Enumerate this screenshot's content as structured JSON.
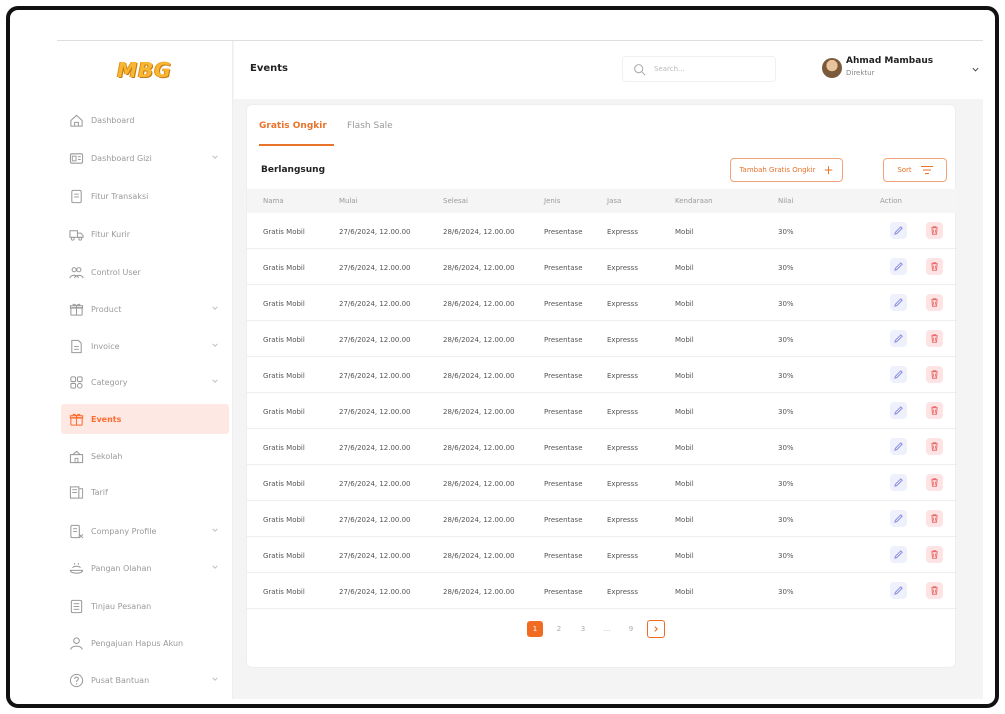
{
  "app": {
    "logo": "MBG",
    "accent": "#e8732a"
  },
  "sidebar": {
    "items": [
      {
        "label": "Dashboard",
        "icon": "home-icon",
        "chevron": false,
        "active": false
      },
      {
        "label": "Dashboard Gizi",
        "icon": "dashboard-gizi-icon",
        "chevron": true,
        "active": false
      },
      {
        "label": "Fitur Transaksi",
        "icon": "document-icon",
        "chevron": false,
        "active": false
      },
      {
        "label": "Fitur Kurir",
        "icon": "truck-icon",
        "chevron": false,
        "active": false
      },
      {
        "label": "Control User",
        "icon": "users-icon",
        "chevron": false,
        "active": false
      },
      {
        "label": "Product",
        "icon": "gift-icon",
        "chevron": true,
        "active": false
      },
      {
        "label": "Invoice",
        "icon": "invoice-icon",
        "chevron": true,
        "active": false
      },
      {
        "label": "Category",
        "icon": "category-icon",
        "chevron": true,
        "active": false
      },
      {
        "label": "Events",
        "icon": "gift-icon",
        "chevron": false,
        "active": true
      },
      {
        "label": "Sekolah",
        "icon": "school-icon",
        "chevron": false,
        "active": false
      },
      {
        "label": "Tarif",
        "icon": "tarif-icon",
        "chevron": false,
        "active": false
      },
      {
        "label": "Company Profile",
        "icon": "company-icon",
        "chevron": true,
        "active": false
      },
      {
        "label": "Pangan Olahan",
        "icon": "food-icon",
        "chevron": true,
        "active": false
      },
      {
        "label": "Tinjau Pesanan",
        "icon": "list-icon",
        "chevron": false,
        "active": false
      },
      {
        "label": "Pengajuan Hapus Akun",
        "icon": "user-delete-icon",
        "chevron": false,
        "active": false
      },
      {
        "label": "Pusat Bantuan",
        "icon": "help-icon",
        "chevron": true,
        "active": false
      }
    ]
  },
  "header": {
    "title": "Events",
    "search_placeholder": "Search...",
    "user_name": "Ahmad Mambaus",
    "user_role": "Direktur"
  },
  "tabs": [
    {
      "label": "Gratis Ongkir",
      "active": true
    },
    {
      "label": "Flash Sale",
      "active": false
    }
  ],
  "section": {
    "title": "Berlangsung",
    "add_label": "Tambah Gratis Ongkir",
    "sort_label": "Sort"
  },
  "table": {
    "columns": [
      "Nama",
      "Mulai",
      "Selesai",
      "Jenis",
      "Jasa",
      "Kendaraan",
      "Nilai",
      "Action"
    ],
    "rows": [
      [
        "Gratis Mobil",
        "27/6/2024, 12.00.00",
        "28/6/2024, 12.00.00",
        "Presentase",
        "Expresss",
        "Mobil",
        "30%"
      ],
      [
        "Gratis Mobil",
        "27/6/2024, 12.00.00",
        "28/6/2024, 12.00.00",
        "Presentase",
        "Expresss",
        "Mobil",
        "30%"
      ],
      [
        "Gratis Mobil",
        "27/6/2024, 12.00.00",
        "28/6/2024, 12.00.00",
        "Presentase",
        "Expresss",
        "Mobil",
        "30%"
      ],
      [
        "Gratis Mobil",
        "27/6/2024, 12.00.00",
        "28/6/2024, 12.00.00",
        "Presentase",
        "Expresss",
        "Mobil",
        "30%"
      ],
      [
        "Gratis Mobil",
        "27/6/2024, 12.00.00",
        "28/6/2024, 12.00.00",
        "Presentase",
        "Expresss",
        "Mobil",
        "30%"
      ],
      [
        "Gratis Mobil",
        "27/6/2024, 12.00.00",
        "28/6/2024, 12.00.00",
        "Presentase",
        "Expresss",
        "Mobil",
        "30%"
      ],
      [
        "Gratis Mobil",
        "27/6/2024, 12.00.00",
        "28/6/2024, 12.00.00",
        "Presentase",
        "Expresss",
        "Mobil",
        "30%"
      ],
      [
        "Gratis Mobil",
        "27/6/2024, 12.00.00",
        "28/6/2024, 12.00.00",
        "Presentase",
        "Expresss",
        "Mobil",
        "30%"
      ],
      [
        "Gratis Mobil",
        "27/6/2024, 12.00.00",
        "28/6/2024, 12.00.00",
        "Presentase",
        "Expresss",
        "Mobil",
        "30%"
      ],
      [
        "Gratis Mobil",
        "27/6/2024, 12.00.00",
        "28/6/2024, 12.00.00",
        "Presentase",
        "Expresss",
        "Mobil",
        "30%"
      ],
      [
        "Gratis Mobil",
        "27/6/2024, 12.00.00",
        "28/6/2024, 12.00.00",
        "Presentase",
        "Expresss",
        "Mobil",
        "30%"
      ]
    ]
  },
  "pagination": {
    "pages": [
      "1",
      "2",
      "3",
      "...",
      "9"
    ],
    "current": "1",
    "next_label": ">"
  }
}
